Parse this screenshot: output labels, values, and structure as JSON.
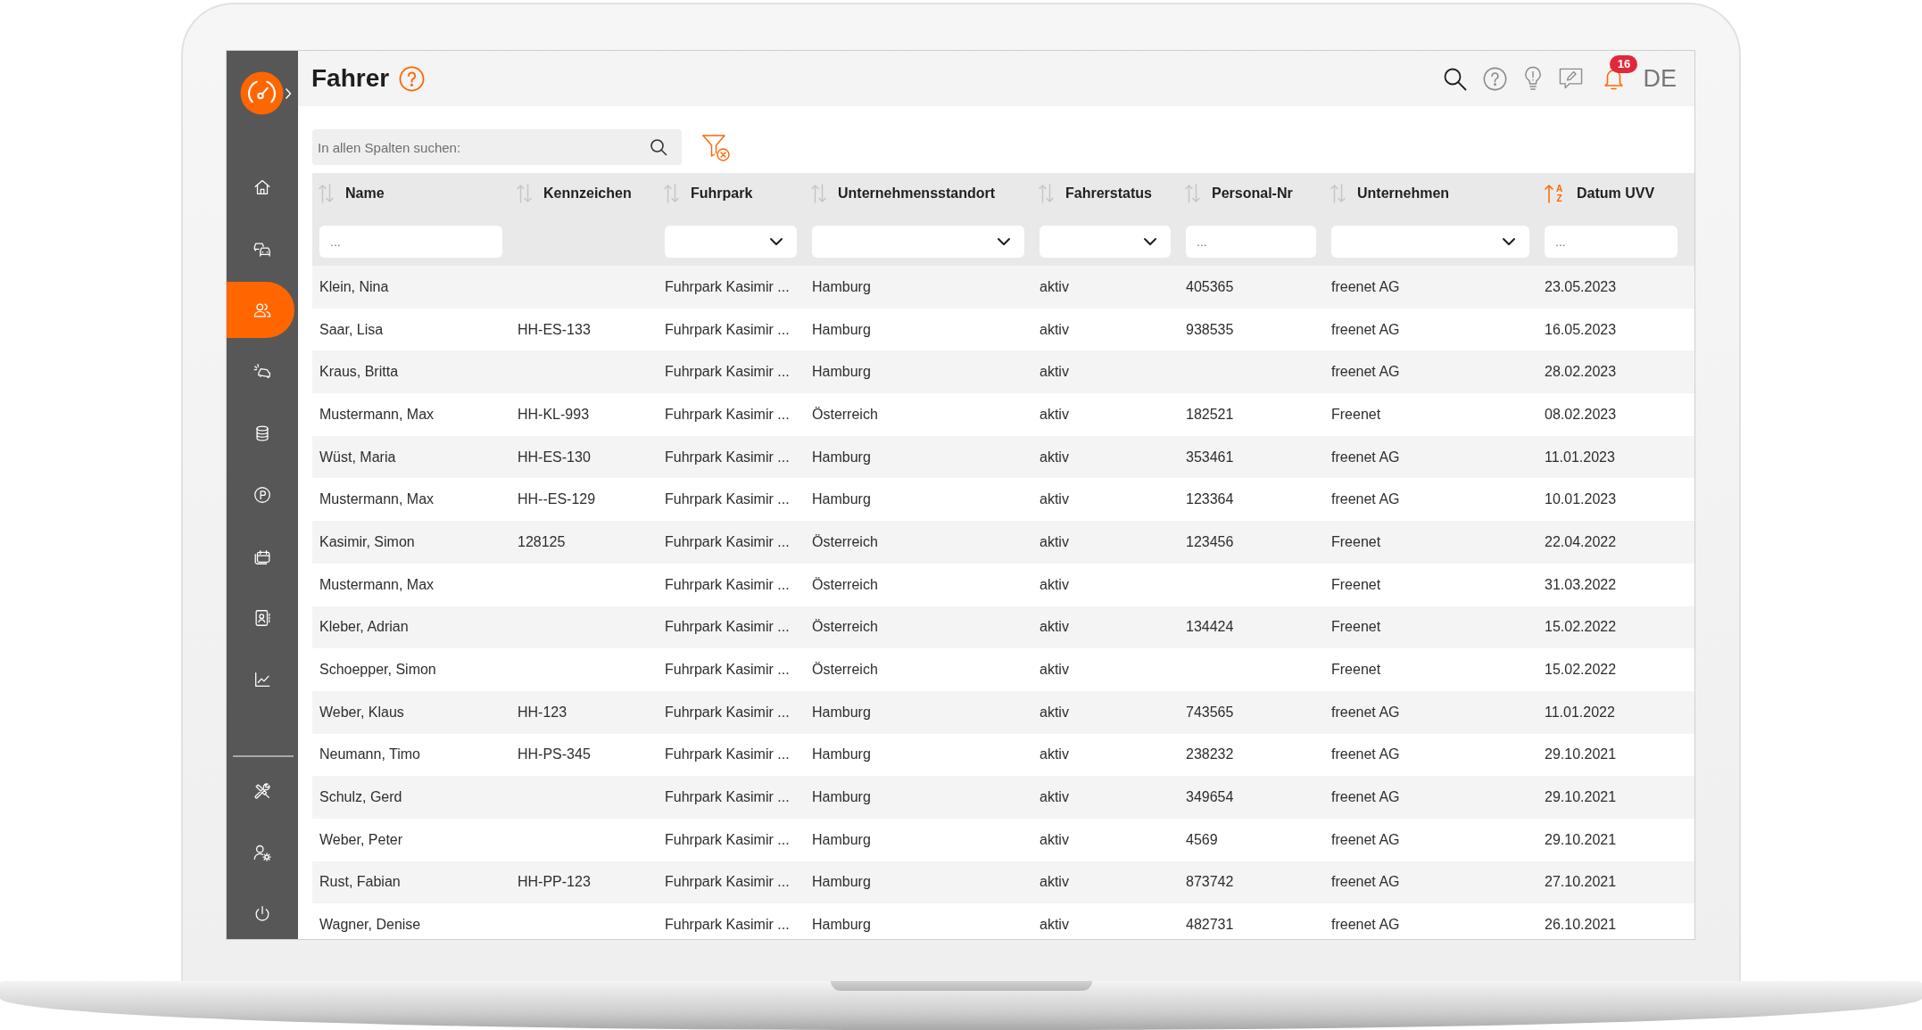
{
  "sidebar": {
    "items": [
      {
        "selected": false
      },
      {
        "selected": false
      },
      {
        "selected": true
      },
      {
        "selected": false
      },
      {
        "selected": false
      },
      {
        "selected": false
      },
      {
        "selected": false
      },
      {
        "selected": false
      },
      {
        "selected": false
      }
    ],
    "bottom_items": [
      {
        "selected": false
      },
      {
        "selected": false
      },
      {
        "selected": false
      }
    ]
  },
  "header": {
    "title": "Fahrer",
    "notifications": {
      "count": "16"
    },
    "language": "DE"
  },
  "toolbar": {
    "search": {
      "placeholder": "In allen Spalten suchen:"
    }
  },
  "table": {
    "columns": [
      {
        "label": "Name",
        "sorted": false,
        "filter": {
          "kind": "text",
          "placeholder": "..."
        }
      },
      {
        "label": "Kennzeichen",
        "sorted": false
      },
      {
        "label": "Fuhrpark",
        "sorted": false,
        "filter": {
          "kind": "select"
        }
      },
      {
        "label": "Unternehmensstandort",
        "sorted": false,
        "filter": {
          "kind": "select"
        }
      },
      {
        "label": "Fahrerstatus",
        "sorted": false,
        "filter": {
          "kind": "select"
        }
      },
      {
        "label": "Personal-Nr",
        "sorted": false,
        "filter": {
          "kind": "text",
          "placeholder": "..."
        }
      },
      {
        "label": "Unternehmen",
        "sorted": false,
        "filter": {
          "kind": "select"
        }
      },
      {
        "label": "Datum UVV",
        "sorted": true,
        "sort_letters": [
          "A",
          "Z"
        ],
        "filter": {
          "kind": "text",
          "placeholder": "..."
        }
      }
    ],
    "rows": [
      {
        "name": "Klein, Nina",
        "fuhrpark": "Fuhrpark Kasimir ...",
        "unternehmensstandort": "Hamburg",
        "fahrerstatus": "aktiv",
        "personal_nr": "405365",
        "unternehmen": "freenet AG",
        "datum_uvv": "23.05.2023"
      },
      {
        "name": "Saar, Lisa",
        "kennzeichen": "HH-ES-133",
        "fuhrpark": "Fuhrpark Kasimir ...",
        "unternehmensstandort": "Hamburg",
        "fahrerstatus": "aktiv",
        "personal_nr": "938535",
        "unternehmen": "freenet AG",
        "datum_uvv": "16.05.2023"
      },
      {
        "name": "Kraus, Britta",
        "fuhrpark": "Fuhrpark Kasimir ...",
        "unternehmensstandort": "Hamburg",
        "fahrerstatus": "aktiv",
        "unternehmen": "freenet AG",
        "datum_uvv": "28.02.2023"
      },
      {
        "name": "Mustermann, Max",
        "kennzeichen": "HH-KL-993",
        "fuhrpark": "Fuhrpark Kasimir ...",
        "unternehmensstandort": "Österreich",
        "fahrerstatus": "aktiv",
        "personal_nr": "182521",
        "unternehmen": "Freenet",
        "datum_uvv": "08.02.2023"
      },
      {
        "name": "Wüst, Maria",
        "kennzeichen": "HH-ES-130",
        "fuhrpark": "Fuhrpark Kasimir ...",
        "unternehmensstandort": "Hamburg",
        "fahrerstatus": "aktiv",
        "personal_nr": "353461",
        "unternehmen": "freenet AG",
        "datum_uvv": "11.01.2023"
      },
      {
        "name": "Mustermann, Max",
        "kennzeichen": "HH--ES-129",
        "fuhrpark": "Fuhrpark Kasimir ...",
        "unternehmensstandort": "Hamburg",
        "fahrerstatus": "aktiv",
        "personal_nr": "123364",
        "unternehmen": "freenet AG",
        "datum_uvv": "10.01.2023"
      },
      {
        "name": "Kasimir, Simon",
        "kennzeichen": "128125",
        "fuhrpark": "Fuhrpark Kasimir ...",
        "unternehmensstandort": "Österreich",
        "fahrerstatus": "aktiv",
        "personal_nr": "123456",
        "unternehmen": "Freenet",
        "datum_uvv": "22.04.2022"
      },
      {
        "name": "Mustermann, Max",
        "fuhrpark": "Fuhrpark Kasimir ...",
        "unternehmensstandort": "Österreich",
        "fahrerstatus": "aktiv",
        "unternehmen": "Freenet",
        "datum_uvv": "31.03.2022"
      },
      {
        "name": "Kleber, Adrian",
        "fuhrpark": "Fuhrpark Kasimir ...",
        "unternehmensstandort": "Österreich",
        "fahrerstatus": "aktiv",
        "personal_nr": "134424",
        "unternehmen": "Freenet",
        "datum_uvv": "15.02.2022"
      },
      {
        "name": "Schoepper, Simon",
        "fuhrpark": "Fuhrpark Kasimir ...",
        "unternehmensstandort": "Österreich",
        "fahrerstatus": "aktiv",
        "unternehmen": "Freenet",
        "datum_uvv": "15.02.2022"
      },
      {
        "name": "Weber, Klaus",
        "kennzeichen": "HH-123",
        "fuhrpark": "Fuhrpark Kasimir ...",
        "unternehmensstandort": "Hamburg",
        "fahrerstatus": "aktiv",
        "personal_nr": "743565",
        "unternehmen": "freenet AG",
        "datum_uvv": "11.01.2022"
      },
      {
        "name": "Neumann, Timo",
        "kennzeichen": "HH-PS-345",
        "fuhrpark": "Fuhrpark Kasimir ...",
        "unternehmensstandort": "Hamburg",
        "fahrerstatus": "aktiv",
        "personal_nr": "238232",
        "unternehmen": "freenet AG",
        "datum_uvv": "29.10.2021"
      },
      {
        "name": "Schulz, Gerd",
        "fuhrpark": "Fuhrpark Kasimir ...",
        "unternehmensstandort": "Hamburg",
        "fahrerstatus": "aktiv",
        "personal_nr": "349654",
        "unternehmen": "freenet AG",
        "datum_uvv": "29.10.2021"
      },
      {
        "name": "Weber, Peter",
        "fuhrpark": "Fuhrpark Kasimir ...",
        "unternehmensstandort": "Hamburg",
        "fahrerstatus": "aktiv",
        "personal_nr": "4569",
        "unternehmen": "freenet AG",
        "datum_uvv": "29.10.2021"
      },
      {
        "name": "Rust, Fabian",
        "kennzeichen": "HH-PP-123",
        "fuhrpark": "Fuhrpark Kasimir ...",
        "unternehmensstandort": "Hamburg",
        "fahrerstatus": "aktiv",
        "personal_nr": "873742",
        "unternehmen": "freenet AG",
        "datum_uvv": "27.10.2021"
      },
      {
        "name": "Wagner, Denise",
        "fuhrpark": "Fuhrpark Kasimir ...",
        "unternehmensstandort": "Hamburg",
        "fahrerstatus": "aktiv",
        "personal_nr": "482731",
        "unternehmen": "freenet AG",
        "datum_uvv": "26.10.2021"
      }
    ]
  }
}
